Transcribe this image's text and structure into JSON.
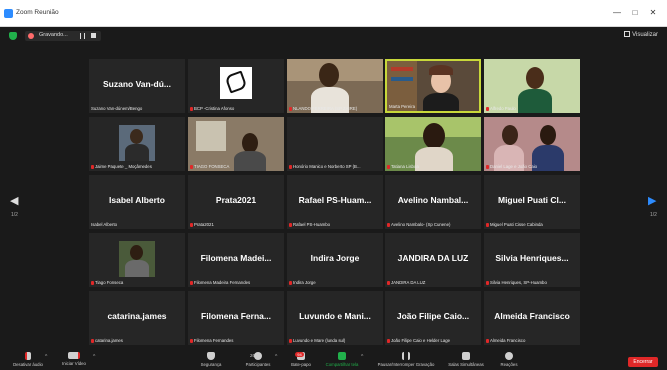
{
  "window": {
    "title": "Zoom Reunião"
  },
  "recording": {
    "label": "Gravando..."
  },
  "view_label": "Visualizar",
  "tiles": [
    {
      "big": "Suzano Van-dú...",
      "label": "Suzano Van-dúnem/Bengo",
      "muted": false
    },
    {
      "big": "",
      "label": "BCP -Cristina Afonso",
      "muted": true
    },
    {
      "big": "",
      "label": "NLANDO FERREIRA (SP ZAIRE)",
      "muted": true
    },
    {
      "big": "",
      "label": "Marta Pereira",
      "muted": false,
      "speaking": true
    },
    {
      "big": "",
      "label": "Alfredo Paulo",
      "muted": true
    },
    {
      "big": "",
      "label": "Jaime Paquete _ Moçâmedes",
      "muted": true
    },
    {
      "big": "",
      "label": "TIAGO FONSECA",
      "muted": true
    },
    {
      "big": "",
      "label": "Honório Manico e Norberto SP (B...",
      "muted": true
    },
    {
      "big": "",
      "label": "Tatiana Lisboa",
      "muted": true
    },
    {
      "big": "",
      "label": "Daniel Lage e João Caio",
      "muted": true
    },
    {
      "big": "Isabel Alberto",
      "label": "Isabel Alberto",
      "muted": false
    },
    {
      "big": "Prata2021",
      "label": "Prata2021",
      "muted": true
    },
    {
      "big": "Rafael PS-Huam...",
      "label": "Rafael PS-Huambo",
      "muted": true
    },
    {
      "big": "Avelino Nambal...",
      "label": "Avelino Nambalo- (Sp Cunene)",
      "muted": true
    },
    {
      "big": "Miguel Puati Cl...",
      "label": "Miguel Puati Cisse Cabinda",
      "muted": true
    },
    {
      "big": "",
      "label": "Tiago Fonseca",
      "muted": true
    },
    {
      "big": "Filomena Madei...",
      "label": "Filomena Madeira Fernandes",
      "muted": true
    },
    {
      "big": "Indira Jorge",
      "label": "Indira Jorge",
      "muted": true
    },
    {
      "big": "JANDIRA DA LUZ",
      "label": "JANDIRA DA LUZ",
      "muted": true
    },
    {
      "big": "Silvia Henriques...",
      "label": "Silvia Henriques, SP-Huambo",
      "muted": true
    },
    {
      "big": "catarina.james",
      "label": "catarina.james",
      "muted": true
    },
    {
      "big": "Filomena Ferna...",
      "label": "Filomena Fernandes",
      "muted": true
    },
    {
      "big": "Luvundo e Mani...",
      "label": "Luvundo e Mare (lunda sul)",
      "muted": true
    },
    {
      "big": "João Filipe Caio...",
      "label": "João Filipe Caio e Helder Lage",
      "muted": true
    },
    {
      "big": "Almeida Francisco",
      "label": "Almeida Francisco",
      "muted": true
    }
  ],
  "nav": {
    "left_page": "1/2",
    "right_page": "1/2"
  },
  "toolbar": {
    "mute": "Desativar áudio",
    "video": "Iniciar Vídeo",
    "security": "Segurança",
    "participants": "Participantes",
    "participants_count": "26",
    "chat": "Bate-papo",
    "chat_badge": "94",
    "share": "Compartilhar tela",
    "recording": "Pausar/Interromper Gravação",
    "breakout": "Salas Simultâneas",
    "reactions": "Reações",
    "end": "Encerrar"
  }
}
